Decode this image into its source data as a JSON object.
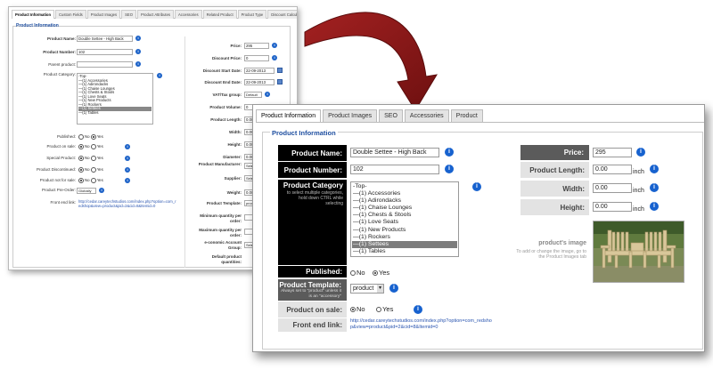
{
  "back": {
    "tabs": [
      "Product Information",
      "Custom Fields",
      "Product Images",
      "SEO",
      "Product Attributes",
      "Accessories",
      "Related Product",
      "Product Type",
      "Discount Calculator"
    ],
    "legend": "Product Information",
    "left": {
      "product_name_label": "Product Name:",
      "product_name_value": "Double Settee - High Back",
      "product_number_label": "Product Number:",
      "product_number_value": "102",
      "parent_product_label": "Parent product:",
      "product_category_label": "Product Category:",
      "categories": [
        "-Top-",
        "—(1) Accessories",
        "—(1) Adirondacks",
        "—(1) Chaise Lounges",
        "—(1) Chests & Stools",
        "—(1) Love Seats",
        "—(1) New Products",
        "—(1) Rockers",
        "—(1) Settees",
        "—(1) Tables"
      ],
      "selected_category": "—(1) Settees",
      "published_label": "Published:",
      "product_on_sale_label": "Product on sale:",
      "special_product_label": "Special Product:",
      "product_discontinued_label": "Product Discontinued:",
      "product_not_for_sale_label": "Product not for sale:",
      "product_preorder_label": "Product Pre-Order:",
      "preorder_value": "Globally",
      "no_label": "No",
      "yes_label": "Yes",
      "front_end_link_label": "Front end link:",
      "front_end_link_value": "http://cedar.careytechstudios.com/index.php?option=com_redshop&view=product&pid=2&cid=8&Itemid=0"
    },
    "right": {
      "price_label": "Price:",
      "price_value": "295",
      "discount_price_label": "Discount Price:",
      "discount_price_value": "0",
      "discount_start_label": "Discount Start Date:",
      "discount_start_value": "22-09-2013",
      "discount_end_label": "Discount End Date:",
      "discount_end_value": "22-09-2013",
      "vat_label": "VAT/Tax group:",
      "vat_value": "Default",
      "product_volume_label": "Product Volume:",
      "product_volume_value": "0",
      "product_volume_unit": "inch3",
      "product_length_label": "Product Length:",
      "product_length_value": "0.00",
      "width_label": "Width:",
      "width_value": "0.00",
      "height_label": "Height:",
      "height_value": "0.00",
      "diameter_label": "Diameter:",
      "diameter_value": "0.00",
      "manufacturer_label": "Product Manufacturer:",
      "manufacturer_value": "Select",
      "supplier_label": "Supplier:",
      "supplier_value": "Select",
      "weight_label": "Weight:",
      "weight_value": "0.00",
      "template_label": "Product Template:",
      "template_value": "product",
      "min_qty_label": "Minimum quantity per order:",
      "max_qty_label": "Maximum quantity per order:",
      "ecommerce_label": "e-conomic Account Group:",
      "ecommerce_value": "Select",
      "default_qty_label": "Default product quantities:"
    }
  },
  "front": {
    "tabs": [
      "Product Information",
      "Product Images",
      "SEO",
      "Accessories",
      "Product"
    ],
    "legend": "Product Information",
    "product_name_label": "Product Name:",
    "product_name_value": "Double Settee - High Back",
    "product_number_label": "Product Number:",
    "product_number_value": "102",
    "product_category_label": "Product Category",
    "product_category_hint": "to select multiple categories, hold down CTRL while selecting",
    "categories": [
      "-Top-",
      "—(1) Accessories",
      "—(1) Adirondacks",
      "—(1) Chaise Lounges",
      "—(1) Chests & Stools",
      "—(1) Love Seats",
      "—(1) New Products",
      "—(1) Rockers",
      "—(1) Settees",
      "—(1) Tables"
    ],
    "selected_category": "—(1) Settees",
    "published_label": "Published:",
    "no_label": "No",
    "yes_label": "Yes",
    "template_label": "Product Template:",
    "template_hint": "Always set to \"product\" unless it is an \"accessory\"",
    "template_value": "product",
    "on_sale_label": "Product on sale:",
    "front_end_link_label": "Front end link:",
    "front_end_link_value": "http://cedar.careytechstudios.com/index.php?option=com_redshop&view=product&pid=2&cid=8&Itemid=0",
    "price_label": "Price:",
    "price_value": "295",
    "length_label": "Product Length:",
    "length_value": "0.00",
    "width_label": "Width:",
    "width_value": "0.00",
    "height_label": "Height:",
    "height_value": "0.00",
    "unit": "inch",
    "image_title": "product's image",
    "image_hint": "To add or change the image, go to the Product Images tab"
  },
  "colors": {
    "arrow": "#8c1a1a",
    "help": "#1762cf",
    "legend": "#1f4fa0"
  }
}
